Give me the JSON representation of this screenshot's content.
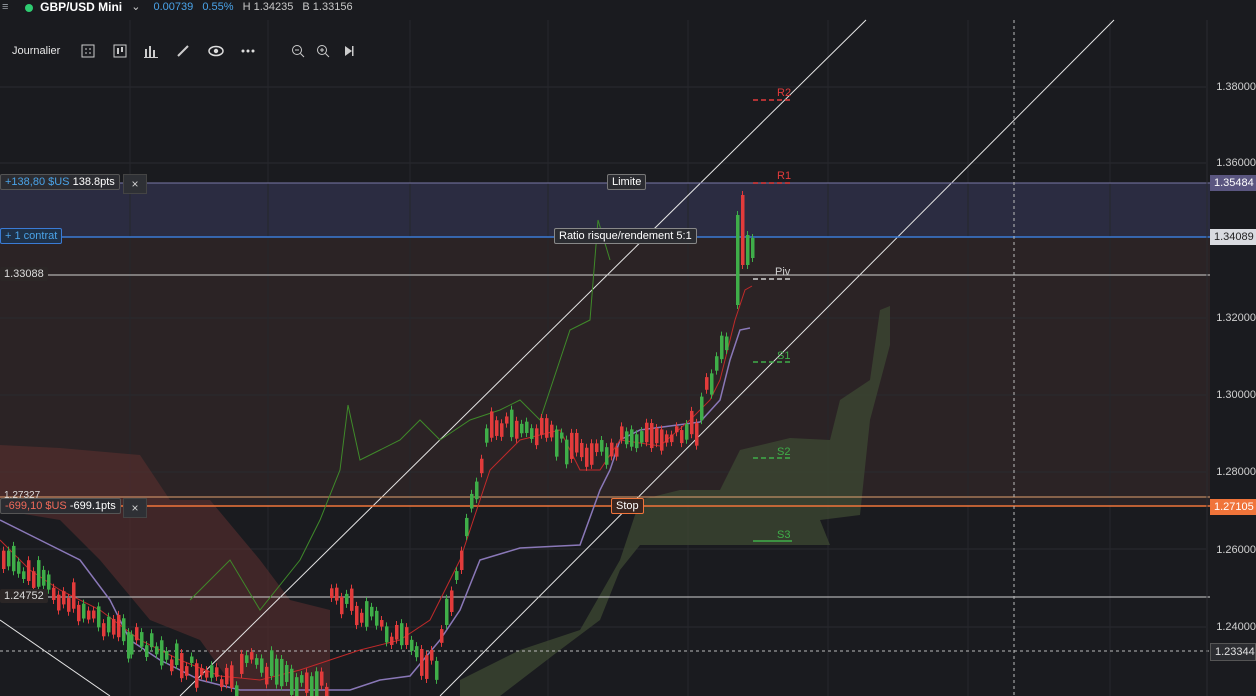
{
  "header": {
    "menu_icon": "hamburger-icon",
    "status_color": "#2ecc71",
    "instrument": "GBP/USD Mini",
    "change": "0.00739",
    "change_pct": "0.55%",
    "high": "H 1.34235",
    "low": "B 1.33156"
  },
  "toolbar": {
    "timeframe": "Journalier",
    "icons": [
      "calculator-icon",
      "candle-type-icon",
      "bar-chart-icon",
      "draw-pencil-icon",
      "eye-icon",
      "more-icon",
      "zoom-out-icon",
      "zoom-in-icon",
      "skip-end-icon"
    ]
  },
  "axis": {
    "ticks": [
      "1.38000",
      "1.36000",
      "1.32000",
      "1.30000",
      "1.28000",
      "1.26000",
      "1.24000"
    ],
    "limit_price": "1.35484",
    "current_price": "1.34089",
    "stop_price": "1.27105",
    "dashed_price": "1.23344"
  },
  "position": {
    "limit_pnl": "+138,80 $US",
    "limit_pts": "138.8pts",
    "contract": "+ 1 contrat",
    "entry_price": "1.33088",
    "stop_value_left": "1.27327",
    "stop_pnl": "-699,10 $US",
    "stop_pts": "-699.1pts",
    "lower_price": "1.24752",
    "limit_label": "Limite",
    "stop_label": "Stop",
    "ratio_label": "Ratio risque/rendement 5:1",
    "close": "×"
  },
  "pivots": {
    "r2": "R2",
    "r1": "R1",
    "piv": "Piv",
    "s1": "S1",
    "s2": "S2",
    "s3": "S3"
  },
  "colors": {
    "up": "#3fae49",
    "down": "#e23b3b",
    "limit_zone": "#3b3a5c",
    "stop_zone": "#3a2a2a",
    "limit_tag": "#5a5680",
    "stop_tag": "#f0743a",
    "current_tag": "#d9dbe0"
  }
}
